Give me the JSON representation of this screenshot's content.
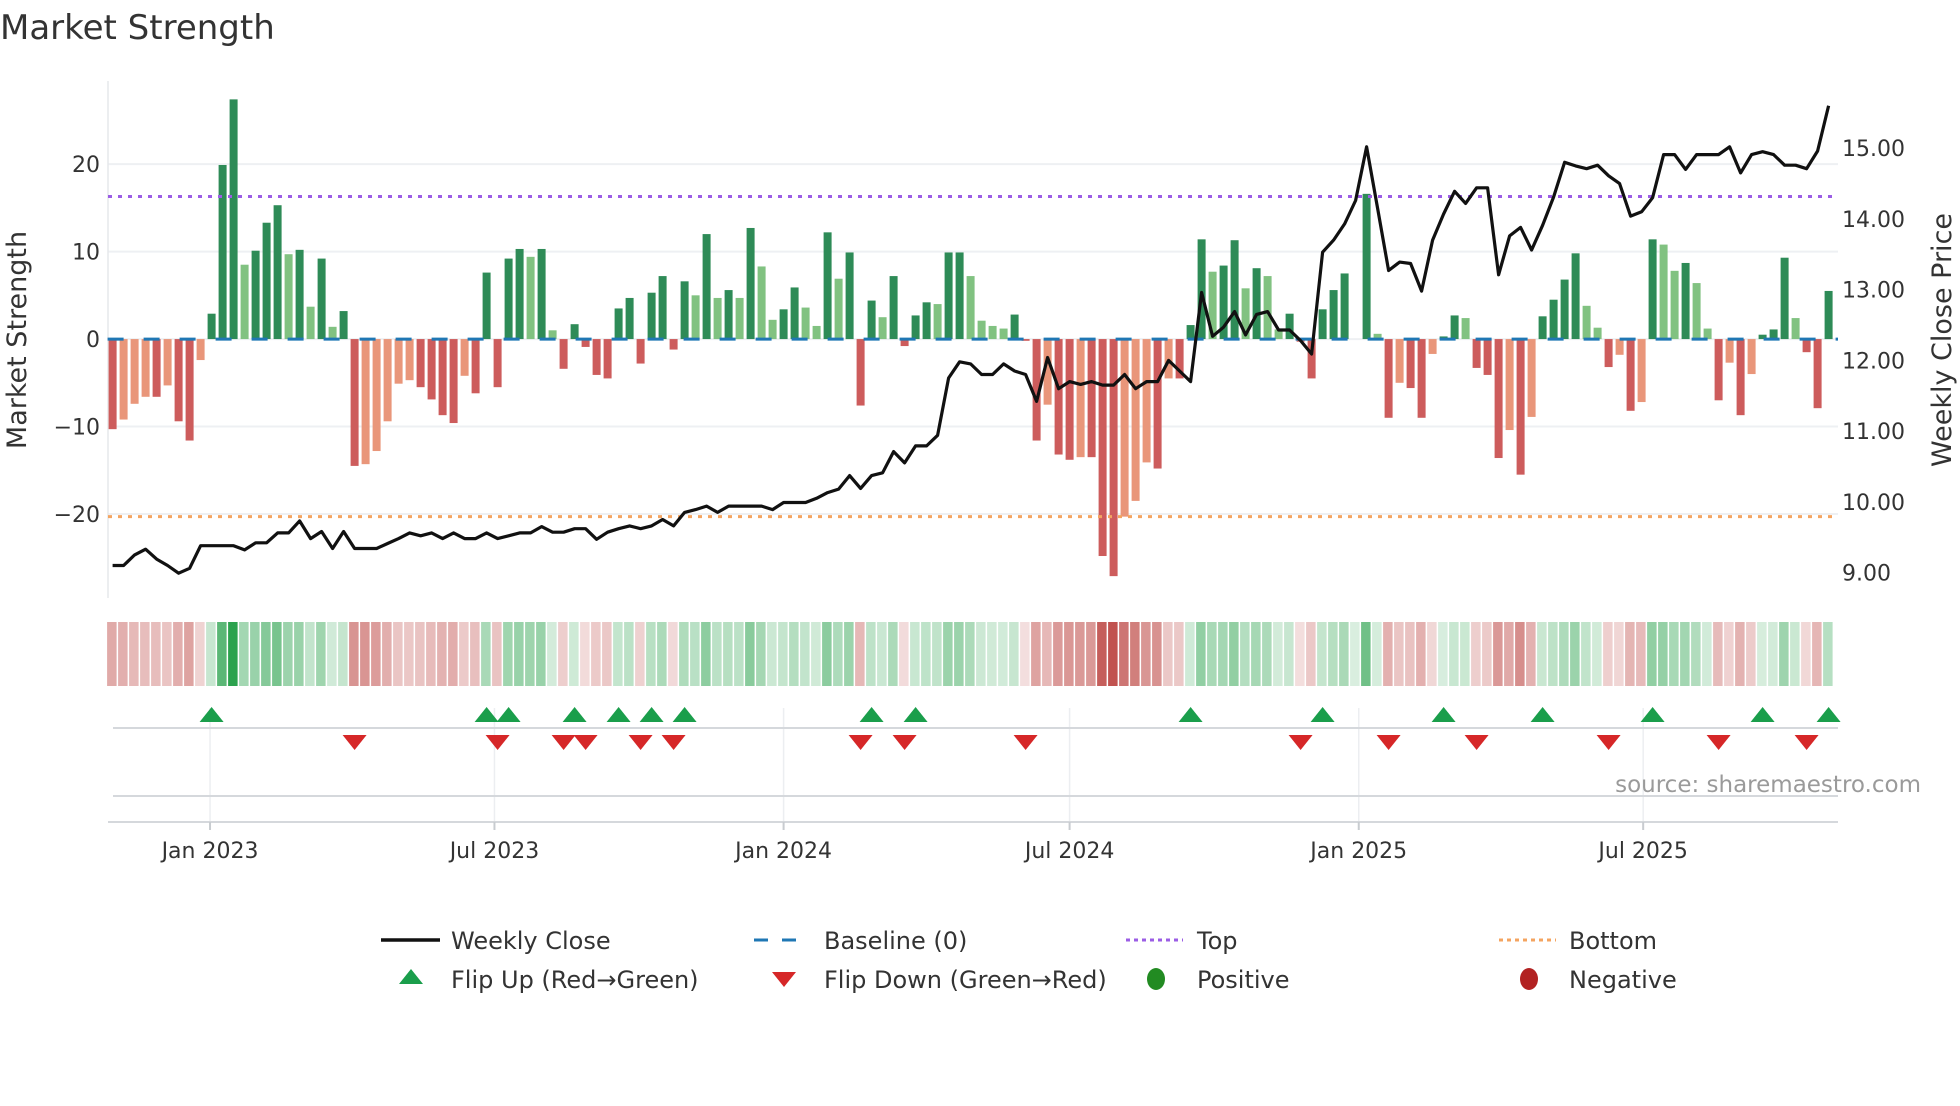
{
  "title": "Market Strength",
  "source": "source: sharemaestro.com",
  "colors": {
    "pos_rising": "#2e8b57",
    "pos_falling": "#81c281",
    "neg_falling": "#cd5c5c",
    "neg_rising": "#e9967a",
    "baseline": "#1f77b4",
    "top": "#9b5de5",
    "bottom": "#f4a460",
    "close": "#111111",
    "flip_up": "#1a9e4b",
    "flip_down": "#d62728",
    "heat_pos": "#2ca24e",
    "heat_neg": "#c0504d",
    "positive": "#228b22",
    "negative": "#b22222"
  },
  "legend": {
    "close": "Weekly Close",
    "baseline": "Baseline (0)",
    "top": "Top",
    "bottom": "Bottom",
    "flip_up": "Flip Up (Red→Green)",
    "flip_down": "Flip Down (Green→Red)",
    "positive": "Positive",
    "negative": "Negative"
  },
  "chart_data": {
    "type": "bar",
    "title": "Market Strength",
    "ylabel": "Market Strength",
    "y2label": "Weekly Close Price",
    "ylim": [
      -29.6,
      29.5
    ],
    "y2lim": [
      8.64,
      15.95
    ],
    "yticks": [
      "20",
      "10",
      "0",
      "−10",
      "−20"
    ],
    "ytick_values": [
      20,
      10,
      0,
      -10,
      -20
    ],
    "y2ticks": [
      "15.00",
      "14.00",
      "13.00",
      "12.00",
      "11.00",
      "10.00",
      "9.00"
    ],
    "y2tick_values": [
      15,
      14,
      13,
      12,
      11,
      10,
      9
    ],
    "x_start": "2022-10-31",
    "x_interval_days": 7,
    "xticks": [
      {
        "label": "Jan 2023",
        "date": "2023-01-01"
      },
      {
        "label": "Jul 2023",
        "date": "2023-07-01"
      },
      {
        "label": "Jan 2024",
        "date": "2024-01-01"
      },
      {
        "label": "Jul 2024",
        "date": "2024-07-01"
      },
      {
        "label": "Jan 2025",
        "date": "2025-01-01"
      },
      {
        "label": "Jul 2025",
        "date": "2025-07-01"
      }
    ],
    "top": 16.3,
    "bottom": -20.3,
    "baseline": 0,
    "strength": [
      -10.3,
      -9.2,
      -7.4,
      -6.6,
      -6.6,
      -5.3,
      -9.4,
      -11.6,
      -2.4,
      2.9,
      19.9,
      27.4,
      8.5,
      10.1,
      13.3,
      15.3,
      9.7,
      10.2,
      3.7,
      9.2,
      1.4,
      3.2,
      -14.5,
      -14.3,
      -12.8,
      -9.4,
      -5.1,
      -4.7,
      -5.5,
      -6.9,
      -8.7,
      -9.6,
      -4.2,
      -6.2,
      7.6,
      -5.5,
      9.2,
      10.3,
      9.4,
      10.3,
      1.0,
      -3.4,
      1.7,
      -0.9,
      -4.1,
      -4.5,
      3.5,
      4.7,
      -2.8,
      5.3,
      7.2,
      -1.2,
      6.6,
      5.0,
      12.0,
      4.7,
      5.6,
      4.7,
      12.7,
      8.3,
      2.2,
      3.4,
      5.9,
      3.6,
      1.5,
      12.2,
      6.9,
      9.9,
      -7.6,
      4.4,
      2.5,
      7.2,
      -0.8,
      2.7,
      4.2,
      4.0,
      9.9,
      9.9,
      7.2,
      2.1,
      1.5,
      1.2,
      2.8,
      -0.2,
      -11.6,
      -7.5,
      -13.2,
      -13.8,
      -13.5,
      -13.5,
      -24.8,
      -27.1,
      -20.3,
      -18.5,
      -14.1,
      -14.8,
      -4.5,
      -4.5,
      1.6,
      11.4,
      7.7,
      8.4,
      11.3,
      5.8,
      8.1,
      7.2,
      1.1,
      2.9,
      -0.3,
      -4.5,
      3.4,
      5.6,
      7.5,
      0,
      16.6,
      0.6,
      -9.0,
      -5.0,
      -5.6,
      -9.0,
      -1.7,
      0.3,
      2.7,
      2.4,
      -3.3,
      -4.1,
      -13.6,
      -10.4,
      -15.5,
      -8.9,
      2.6,
      4.5,
      6.8,
      9.8,
      3.8,
      1.3,
      -3.2,
      -1.8,
      -8.2,
      -7.2,
      11.4,
      10.8,
      7.8,
      8.7,
      6.4,
      1.2,
      -7.0,
      -2.7,
      -8.7,
      -4.0,
      0.5,
      1.1,
      9.3,
      2.4,
      -1.5,
      -7.9,
      5.5
    ],
    "close": [
      9.1,
      9.1,
      9.25,
      9.33,
      9.19,
      9.1,
      8.99,
      9.06,
      9.38,
      9.38,
      9.38,
      9.38,
      9.32,
      9.42,
      9.42,
      9.56,
      9.56,
      9.73,
      9.48,
      9.58,
      9.34,
      9.58,
      9.34,
      9.34,
      9.34,
      9.41,
      9.48,
      9.56,
      9.52,
      9.56,
      9.48,
      9.56,
      9.48,
      9.48,
      9.56,
      9.48,
      9.52,
      9.56,
      9.56,
      9.65,
      9.57,
      9.57,
      9.62,
      9.62,
      9.47,
      9.57,
      9.62,
      9.66,
      9.62,
      9.66,
      9.75,
      9.66,
      9.85,
      9.89,
      9.94,
      9.85,
      9.94,
      9.94,
      9.94,
      9.94,
      9.89,
      9.99,
      9.99,
      9.99,
      10.05,
      10.13,
      10.18,
      10.37,
      10.19,
      10.37,
      10.41,
      10.71,
      10.55,
      10.79,
      10.79,
      10.94,
      11.75,
      11.98,
      11.95,
      11.8,
      11.8,
      11.95,
      11.85,
      11.8,
      11.42,
      12.04,
      11.6,
      11.7,
      11.66,
      11.7,
      11.65,
      11.65,
      11.8,
      11.6,
      11.7,
      11.7,
      12.0,
      11.85,
      11.7,
      12.96,
      12.34,
      12.47,
      12.69,
      12.36,
      12.65,
      12.69,
      12.43,
      12.43,
      12.28,
      12.09,
      13.53,
      13.7,
      13.93,
      14.26,
      15.02,
      14.15,
      13.27,
      13.39,
      13.37,
      12.98,
      13.7,
      14.07,
      14.39,
      14.22,
      14.44,
      14.44,
      13.21,
      13.76,
      13.88,
      13.56,
      13.91,
      14.31,
      14.8,
      14.75,
      14.71,
      14.76,
      14.61,
      14.5,
      14.04,
      14.1,
      14.3,
      14.91,
      14.91,
      14.7,
      14.91,
      14.91,
      14.91,
      15.02,
      14.65,
      14.91,
      14.95,
      14.91,
      14.76,
      14.76,
      14.71,
      14.96,
      15.6
    ]
  }
}
